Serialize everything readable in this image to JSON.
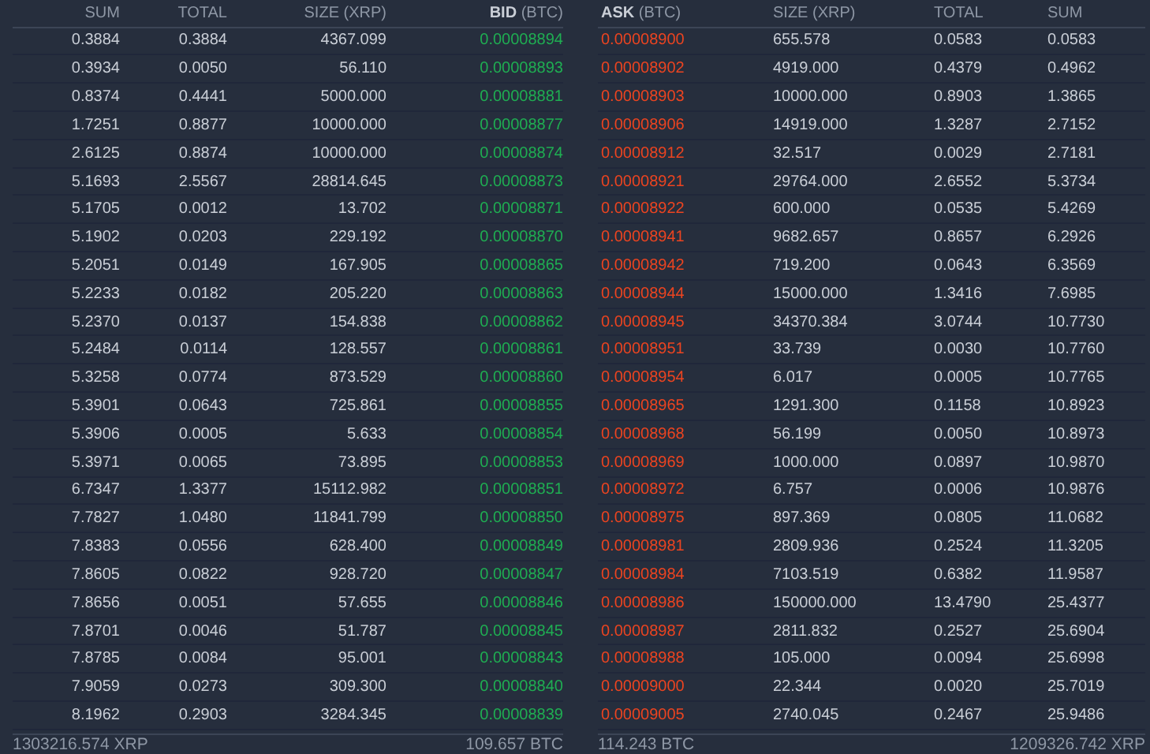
{
  "books": [
    {
      "kind": "bid",
      "columns": [
        {
          "label": "SUM",
          "kind": "amount"
        },
        {
          "label": "TOTAL",
          "kind": "amount"
        },
        {
          "label": "SIZE (XRP)",
          "kind": "amount"
        },
        {
          "label": "**BID** (BTC)",
          "kind": "price"
        }
      ],
      "rows": [
        [
          "0.3884",
          "0.3884",
          "4367.099",
          "0.00008894"
        ],
        [
          "0.3934",
          "0.0050",
          "56.110",
          "0.00008893"
        ],
        [
          "0.8374",
          "0.4441",
          "5000.000",
          "0.00008881"
        ],
        [
          "1.7251",
          "0.8877",
          "10000.000",
          "0.00008877"
        ],
        [
          "2.6125",
          "0.8874",
          "10000.000",
          "0.00008874"
        ],
        [
          "5.1693",
          "2.5567",
          "28814.645",
          "0.00008873"
        ],
        [
          "5.1705",
          "0.0012",
          "13.702",
          "0.00008871"
        ],
        [
          "5.1902",
          "0.0203",
          "229.192",
          "0.00008870"
        ],
        [
          "5.2051",
          "0.0149",
          "167.905",
          "0.00008865"
        ],
        [
          "5.2233",
          "0.0182",
          "205.220",
          "0.00008863"
        ],
        [
          "5.2370",
          "0.0137",
          "154.838",
          "0.00008862"
        ],
        [
          "5.2484",
          "0.0114",
          "128.557",
          "0.00008861"
        ],
        [
          "5.3258",
          "0.0774",
          "873.529",
          "0.00008860"
        ],
        [
          "5.3901",
          "0.0643",
          "725.861",
          "0.00008855"
        ],
        [
          "5.3906",
          "0.0005",
          "5.633",
          "0.00008854"
        ],
        [
          "5.3971",
          "0.0065",
          "73.895",
          "0.00008853"
        ],
        [
          "6.7347",
          "1.3377",
          "15112.982",
          "0.00008851"
        ],
        [
          "7.7827",
          "1.0480",
          "11841.799",
          "0.00008850"
        ],
        [
          "7.8383",
          "0.0556",
          "628.400",
          "0.00008849"
        ],
        [
          "7.8605",
          "0.0822",
          "928.720",
          "0.00008847"
        ],
        [
          "7.8656",
          "0.0051",
          "57.655",
          "0.00008846"
        ],
        [
          "7.8701",
          "0.0046",
          "51.787",
          "0.00008845"
        ],
        [
          "7.8785",
          "0.0084",
          "95.001",
          "0.00008843"
        ],
        [
          "7.9059",
          "0.0273",
          "309.300",
          "0.00008840"
        ],
        [
          "8.1962",
          "0.2903",
          "3284.345",
          "0.00008839"
        ]
      ],
      "footer": [
        "1303216.574 XRP",
        "109.657 BTC"
      ]
    },
    {
      "kind": "ask",
      "columns": [
        {
          "label": "**ASK** (BTC)",
          "kind": "price"
        },
        {
          "label": "SIZE (XRP)",
          "kind": "amount"
        },
        {
          "label": "TOTAL",
          "kind": "amount"
        },
        {
          "label": "SUM",
          "kind": "amount"
        }
      ],
      "rows": [
        [
          "0.00008900",
          "655.578",
          "0.0583",
          "0.0583"
        ],
        [
          "0.00008902",
          "4919.000",
          "0.4379",
          "0.4962"
        ],
        [
          "0.00008903",
          "10000.000",
          "0.8903",
          "1.3865"
        ],
        [
          "0.00008906",
          "14919.000",
          "1.3287",
          "2.7152"
        ],
        [
          "0.00008912",
          "32.517",
          "0.0029",
          "2.7181"
        ],
        [
          "0.00008921",
          "29764.000",
          "2.6552",
          "5.3734"
        ],
        [
          "0.00008922",
          "600.000",
          "0.0535",
          "5.4269"
        ],
        [
          "0.00008941",
          "9682.657",
          "0.8657",
          "6.2926"
        ],
        [
          "0.00008942",
          "719.200",
          "0.0643",
          "6.3569"
        ],
        [
          "0.00008944",
          "15000.000",
          "1.3416",
          "7.6985"
        ],
        [
          "0.00008945",
          "34370.384",
          "3.0744",
          "10.7730"
        ],
        [
          "0.00008951",
          "33.739",
          "0.0030",
          "10.7760"
        ],
        [
          "0.00008954",
          "6.017",
          "0.0005",
          "10.7765"
        ],
        [
          "0.00008965",
          "1291.300",
          "0.1158",
          "10.8923"
        ],
        [
          "0.00008968",
          "56.199",
          "0.0050",
          "10.8973"
        ],
        [
          "0.00008969",
          "1000.000",
          "0.0897",
          "10.9870"
        ],
        [
          "0.00008972",
          "6.757",
          "0.0006",
          "10.9876"
        ],
        [
          "0.00008975",
          "897.369",
          "0.0805",
          "11.0682"
        ],
        [
          "0.00008981",
          "2809.936",
          "0.2524",
          "11.3205"
        ],
        [
          "0.00008984",
          "7103.519",
          "0.6382",
          "11.9587"
        ],
        [
          "0.00008986",
          "150000.000",
          "13.4790",
          "25.4377"
        ],
        [
          "0.00008987",
          "2811.832",
          "0.2527",
          "25.6904"
        ],
        [
          "0.00008988",
          "105.000",
          "0.0094",
          "25.6998"
        ],
        [
          "0.00009000",
          "22.344",
          "0.0020",
          "25.7019"
        ],
        [
          "0.00009005",
          "2740.045",
          "0.2467",
          "25.9486"
        ]
      ],
      "footer": [
        "114.243 BTC",
        "1209326.742 XRP"
      ]
    }
  ]
}
